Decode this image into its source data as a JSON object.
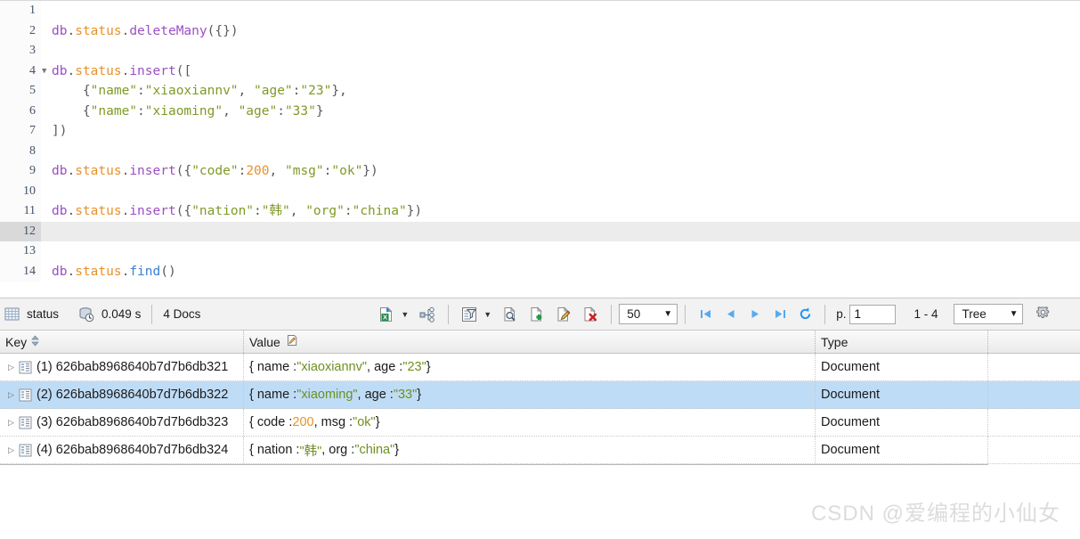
{
  "editor": {
    "active_line": 12,
    "lines": [
      {
        "n": 1,
        "fold": false,
        "tokens": []
      },
      {
        "n": 2,
        "fold": false,
        "tokens": [
          {
            "t": "db",
            "c": "tok-obj"
          },
          {
            "t": ".",
            "c": "tok-punct"
          },
          {
            "t": "status",
            "c": "tok-coll"
          },
          {
            "t": ".",
            "c": "tok-punct"
          },
          {
            "t": "deleteMany",
            "c": "tok-fn"
          },
          {
            "t": "({})",
            "c": "tok-punct"
          }
        ]
      },
      {
        "n": 3,
        "fold": false,
        "tokens": []
      },
      {
        "n": 4,
        "fold": true,
        "tokens": [
          {
            "t": "db",
            "c": "tok-obj"
          },
          {
            "t": ".",
            "c": "tok-punct"
          },
          {
            "t": "status",
            "c": "tok-coll"
          },
          {
            "t": ".",
            "c": "tok-punct"
          },
          {
            "t": "insert",
            "c": "tok-fn"
          },
          {
            "t": "([",
            "c": "tok-punct"
          }
        ]
      },
      {
        "n": 5,
        "fold": false,
        "tokens": [
          {
            "t": "    {",
            "c": "tok-punct"
          },
          {
            "t": "\"name\"",
            "c": "tok-str"
          },
          {
            "t": ":",
            "c": "tok-punct"
          },
          {
            "t": "\"xiaoxiannv\"",
            "c": "tok-str"
          },
          {
            "t": ", ",
            "c": "tok-punct"
          },
          {
            "t": "\"age\"",
            "c": "tok-str"
          },
          {
            "t": ":",
            "c": "tok-punct"
          },
          {
            "t": "\"23\"",
            "c": "tok-str"
          },
          {
            "t": "},",
            "c": "tok-punct"
          }
        ]
      },
      {
        "n": 6,
        "fold": false,
        "tokens": [
          {
            "t": "    {",
            "c": "tok-punct"
          },
          {
            "t": "\"name\"",
            "c": "tok-str"
          },
          {
            "t": ":",
            "c": "tok-punct"
          },
          {
            "t": "\"xiaoming\"",
            "c": "tok-str"
          },
          {
            "t": ", ",
            "c": "tok-punct"
          },
          {
            "t": "\"age\"",
            "c": "tok-str"
          },
          {
            "t": ":",
            "c": "tok-punct"
          },
          {
            "t": "\"33\"",
            "c": "tok-str"
          },
          {
            "t": "}",
            "c": "tok-punct"
          }
        ]
      },
      {
        "n": 7,
        "fold": false,
        "tokens": [
          {
            "t": "])",
            "c": "tok-punct"
          }
        ]
      },
      {
        "n": 8,
        "fold": false,
        "tokens": []
      },
      {
        "n": 9,
        "fold": false,
        "tokens": [
          {
            "t": "db",
            "c": "tok-obj"
          },
          {
            "t": ".",
            "c": "tok-punct"
          },
          {
            "t": "status",
            "c": "tok-coll"
          },
          {
            "t": ".",
            "c": "tok-punct"
          },
          {
            "t": "insert",
            "c": "tok-fn"
          },
          {
            "t": "({",
            "c": "tok-punct"
          },
          {
            "t": "\"code\"",
            "c": "tok-str"
          },
          {
            "t": ":",
            "c": "tok-punct"
          },
          {
            "t": "200",
            "c": "tok-num"
          },
          {
            "t": ", ",
            "c": "tok-punct"
          },
          {
            "t": "\"msg\"",
            "c": "tok-str"
          },
          {
            "t": ":",
            "c": "tok-punct"
          },
          {
            "t": "\"ok\"",
            "c": "tok-str"
          },
          {
            "t": "})",
            "c": "tok-punct"
          }
        ]
      },
      {
        "n": 10,
        "fold": false,
        "tokens": []
      },
      {
        "n": 11,
        "fold": false,
        "tokens": [
          {
            "t": "db",
            "c": "tok-obj"
          },
          {
            "t": ".",
            "c": "tok-punct"
          },
          {
            "t": "status",
            "c": "tok-coll"
          },
          {
            "t": ".",
            "c": "tok-punct"
          },
          {
            "t": "insert",
            "c": "tok-fn"
          },
          {
            "t": "({",
            "c": "tok-punct"
          },
          {
            "t": "\"nation\"",
            "c": "tok-str"
          },
          {
            "t": ":",
            "c": "tok-punct"
          },
          {
            "t": "\"韩\"",
            "c": "tok-str"
          },
          {
            "t": ", ",
            "c": "tok-punct"
          },
          {
            "t": "\"org\"",
            "c": "tok-str"
          },
          {
            "t": ":",
            "c": "tok-punct"
          },
          {
            "t": "\"china\"",
            "c": "tok-str"
          },
          {
            "t": "})",
            "c": "tok-punct"
          }
        ]
      },
      {
        "n": 12,
        "fold": false,
        "tokens": []
      },
      {
        "n": 13,
        "fold": false,
        "tokens": []
      },
      {
        "n": 14,
        "fold": false,
        "tokens": [
          {
            "t": "db",
            "c": "tok-obj"
          },
          {
            "t": ".",
            "c": "tok-punct"
          },
          {
            "t": "status",
            "c": "tok-coll"
          },
          {
            "t": ".",
            "c": "tok-punct"
          },
          {
            "t": "find",
            "c": "tok-fn2"
          },
          {
            "t": "()",
            "c": "tok-punct"
          }
        ]
      }
    ]
  },
  "toolbar": {
    "collection_name": "status",
    "collection_icon": "table-grid-icon",
    "duration": "0.049 s",
    "duration_icon": "database-clock-icon",
    "doc_count": "4 Docs",
    "export_icon": "export-excel-icon",
    "tree_export_icon": "export-hierarchy-icon",
    "filter_icon": "filter-funnel-icon",
    "view_doc_icon": "view-document-icon",
    "add_doc_icon": "add-document-icon",
    "edit_doc_icon": "edit-document-icon",
    "delete_doc_icon": "delete-document-icon",
    "page_size_value": "50",
    "page_size_options": [
      "50"
    ],
    "nav_first_icon": "first-page-icon",
    "nav_prev_icon": "previous-page-icon",
    "nav_next_icon": "next-page-icon",
    "nav_last_icon": "last-page-icon",
    "refresh_icon": "refresh-icon",
    "page_label": "p.",
    "page_value": "1",
    "range_label": "1 - 4",
    "view_mode_value": "Tree",
    "view_mode_options": [
      "Tree"
    ],
    "settings_icon": "gear-icon"
  },
  "grid": {
    "columns": {
      "key": "Key",
      "key_sort_icon": "sort-arrows-icon",
      "value": "Value",
      "value_icon": "edit-note-icon",
      "type": "Type"
    },
    "selected_row_index": 1,
    "rows": [
      {
        "expander": "▷",
        "doc_icon": "document-tree-icon",
        "key": "(1) 626bab8968640b7d7b6db321",
        "type": "Document",
        "value_parts": [
          {
            "t": "{ name : ",
            "c": "v-plain"
          },
          {
            "t": "\"xiaoxiannv\"",
            "c": "v-str"
          },
          {
            "t": ", age : ",
            "c": "v-plain"
          },
          {
            "t": "\"23\"",
            "c": "v-str"
          },
          {
            "t": " }",
            "c": "v-plain"
          }
        ]
      },
      {
        "expander": "▷",
        "doc_icon": "document-tree-icon",
        "key": "(2) 626bab8968640b7d7b6db322",
        "type": "Document",
        "value_parts": [
          {
            "t": "{ name : ",
            "c": "v-plain"
          },
          {
            "t": "\"xiaoming\"",
            "c": "v-str"
          },
          {
            "t": ", age : ",
            "c": "v-plain"
          },
          {
            "t": "\"33\"",
            "c": "v-str"
          },
          {
            "t": " }",
            "c": "v-plain"
          }
        ]
      },
      {
        "expander": "▷",
        "doc_icon": "document-tree-icon",
        "key": "(3) 626bab8968640b7d7b6db323",
        "type": "Document",
        "value_parts": [
          {
            "t": "{ code : ",
            "c": "v-plain"
          },
          {
            "t": "200",
            "c": "v-num"
          },
          {
            "t": ", msg : ",
            "c": "v-plain"
          },
          {
            "t": "\"ok\"",
            "c": "v-str"
          },
          {
            "t": " }",
            "c": "v-plain"
          }
        ]
      },
      {
        "expander": "▷",
        "doc_icon": "document-tree-icon",
        "key": "(4) 626bab8968640b7d7b6db324",
        "type": "Document",
        "value_parts": [
          {
            "t": "{ nation : ",
            "c": "v-plain"
          },
          {
            "t": "\"韩\"",
            "c": "v-str"
          },
          {
            "t": ", org : ",
            "c": "v-plain"
          },
          {
            "t": "\"china\"",
            "c": "v-str"
          },
          {
            "t": " }",
            "c": "v-plain"
          }
        ]
      }
    ]
  },
  "watermark": {
    "text": "CSDN @爱编程的小仙女"
  }
}
